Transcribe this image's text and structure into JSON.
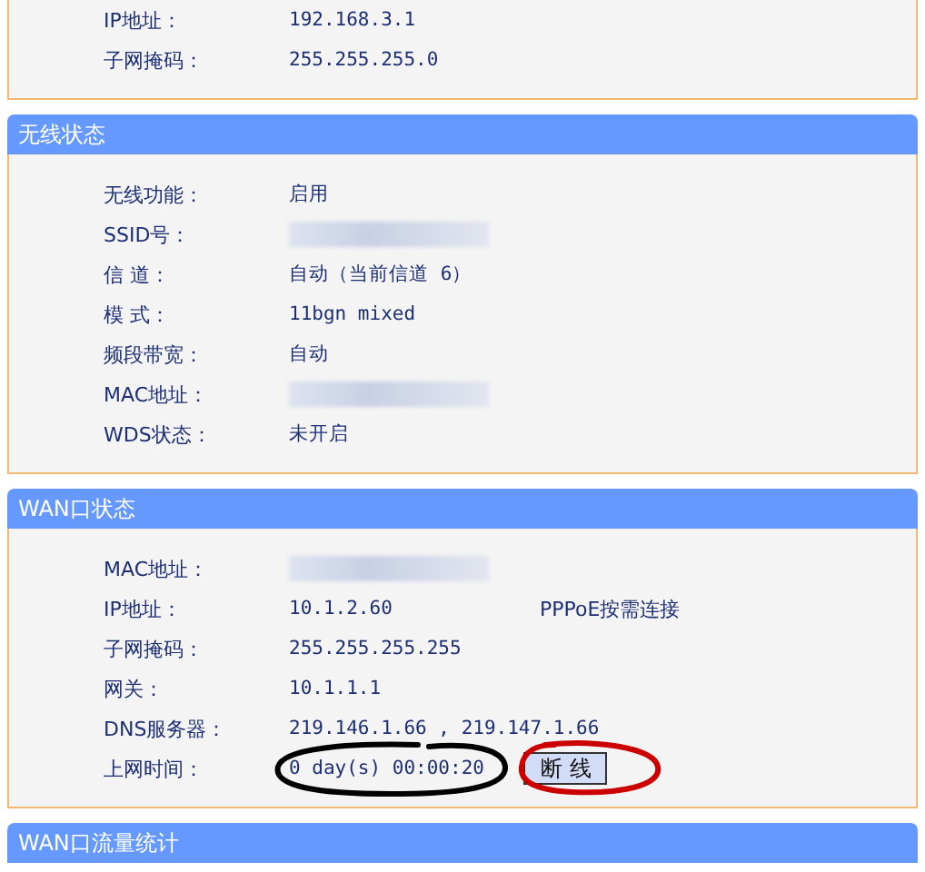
{
  "sections": [
    {
      "rows": [
        {
          "kind": "text",
          "label": "IP地址：",
          "value": "192.168.3.1"
        },
        {
          "kind": "text",
          "label": "子网掩码：",
          "value": "255.255.255.0"
        }
      ]
    },
    {
      "title": "无线状态",
      "rows": [
        {
          "kind": "text",
          "label": "无线功能：",
          "value": "启用"
        },
        {
          "kind": "blurred",
          "label": "SSID号："
        },
        {
          "kind": "text",
          "label": "信 道：",
          "value": "自动（当前信道 6）"
        },
        {
          "kind": "text",
          "label": "模 式：",
          "value": "11bgn mixed"
        },
        {
          "kind": "text",
          "label": "频段带宽：",
          "value": "自动"
        },
        {
          "kind": "blurred",
          "label": "MAC地址："
        },
        {
          "kind": "text",
          "label": "WDS状态：",
          "value": "未开启"
        }
      ]
    },
    {
      "title": "WAN口状态",
      "rows": [
        {
          "kind": "blurred",
          "label": "MAC地址："
        },
        {
          "kind": "text",
          "label": "IP地址：",
          "value": "10.1.2.60",
          "extra": "PPPoE按需连接"
        },
        {
          "kind": "text",
          "label": "子网掩码：",
          "value": "255.255.255.255"
        },
        {
          "kind": "text",
          "label": "网关：",
          "value": "10.1.1.1"
        },
        {
          "kind": "text",
          "label": "DNS服务器：",
          "value": "219.146.1.66 , 219.147.1.66"
        },
        {
          "kind": "button",
          "label": "上网时间：",
          "value": "0 day(s) 00:00:20",
          "button": "断 线"
        }
      ]
    },
    {
      "title": "WAN口流量统计"
    }
  ],
  "annotations": [
    {
      "color": "#000000"
    },
    {
      "color": "#cc0000"
    }
  ]
}
